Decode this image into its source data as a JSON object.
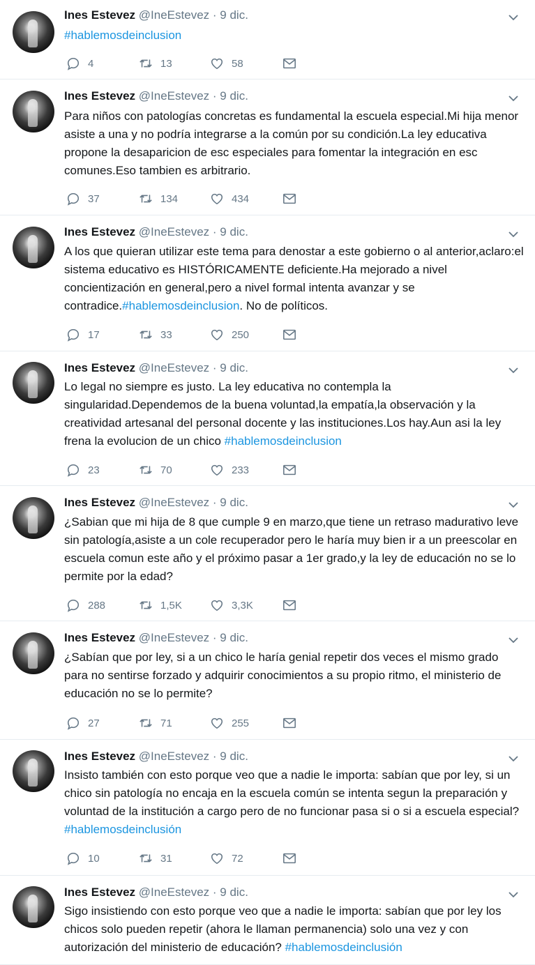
{
  "author": {
    "name": "Ines Estevez",
    "handle": "@IneEstevez",
    "date": "9 dic."
  },
  "separator": "·",
  "tweets": [
    {
      "segments": [
        {
          "text": "#hablemosdeinclusion",
          "tag": true
        }
      ],
      "replies": "4",
      "retweets": "13",
      "likes": "58"
    },
    {
      "segments": [
        {
          "text": "Para niños con patologías concretas es fundamental la escuela especial.Mi hija menor asiste a una y no podría integrarse a la común por su condición.La ley educativa propone la desaparicion de esc especiales para fomentar la integración en esc comunes.Eso tambien es arbitrario.",
          "tag": false
        }
      ],
      "replies": "37",
      "retweets": "134",
      "likes": "434"
    },
    {
      "segments": [
        {
          "text": "A los que quieran utilizar este tema para denostar a este gobierno o al anterior,aclaro:el sistema educativo es HISTÓRICAMENTE deficiente.Ha mejorado a nivel concientización en general,pero a nivel formal intenta avanzar y se contradice.",
          "tag": false
        },
        {
          "text": "#hablemosdeinclusion",
          "tag": true
        },
        {
          "text": ". No de políticos.",
          "tag": false
        }
      ],
      "replies": "17",
      "retweets": "33",
      "likes": "250"
    },
    {
      "segments": [
        {
          "text": "Lo legal no siempre es justo. La ley educativa no contempla la singularidad.Dependemos de la buena voluntad,la empatía,la observación y la creatividad artesanal del personal docente y las instituciones.Los hay.Aun asi la ley frena la evolucion de un chico ",
          "tag": false
        },
        {
          "text": "#hablemosdeinclusion",
          "tag": true
        }
      ],
      "replies": "23",
      "retweets": "70",
      "likes": "233"
    },
    {
      "segments": [
        {
          "text": "¿Sabian que mi hija de 8 que cumple 9 en marzo,que tiene un retraso madurativo leve sin patología,asiste a un cole recuperador pero le haría muy bien ir a un preescolar en escuela comun este año y el próximo pasar a 1er grado,y la ley de educación no se lo permite por la edad?",
          "tag": false
        }
      ],
      "replies": "288",
      "retweets": "1,5K",
      "likes": "3,3K"
    },
    {
      "segments": [
        {
          "text": "¿Sabían que por ley, si a un chico le haría genial repetir dos veces el mismo grado para no sentirse forzado y adquirir conocimientos a su propio ritmo, el ministerio de educación no se lo permite?",
          "tag": false
        }
      ],
      "replies": "27",
      "retweets": "71",
      "likes": "255"
    },
    {
      "segments": [
        {
          "text": "Insisto también con esto porque veo que a nadie le importa: sabían que por ley, si un chico sin patología no encaja en la escuela común se intenta segun la preparación y voluntad de la institución a cargo pero de no funcionar pasa si o si a escuela especial? ",
          "tag": false
        },
        {
          "text": "#hablemosdeinclusión",
          "tag": true
        }
      ],
      "replies": "10",
      "retweets": "31",
      "likes": "72"
    },
    {
      "segments": [
        {
          "text": "Sigo insistiendo con esto porque veo que a nadie le importa: sabían que por ley los chicos solo pueden repetir (ahora le llaman permanencia) solo una vez y con autorización del ministerio de educación? ",
          "tag": false
        },
        {
          "text": "#hablemosdeinclusión",
          "tag": true
        }
      ],
      "replies": "",
      "retweets": "",
      "likes": ""
    }
  ]
}
